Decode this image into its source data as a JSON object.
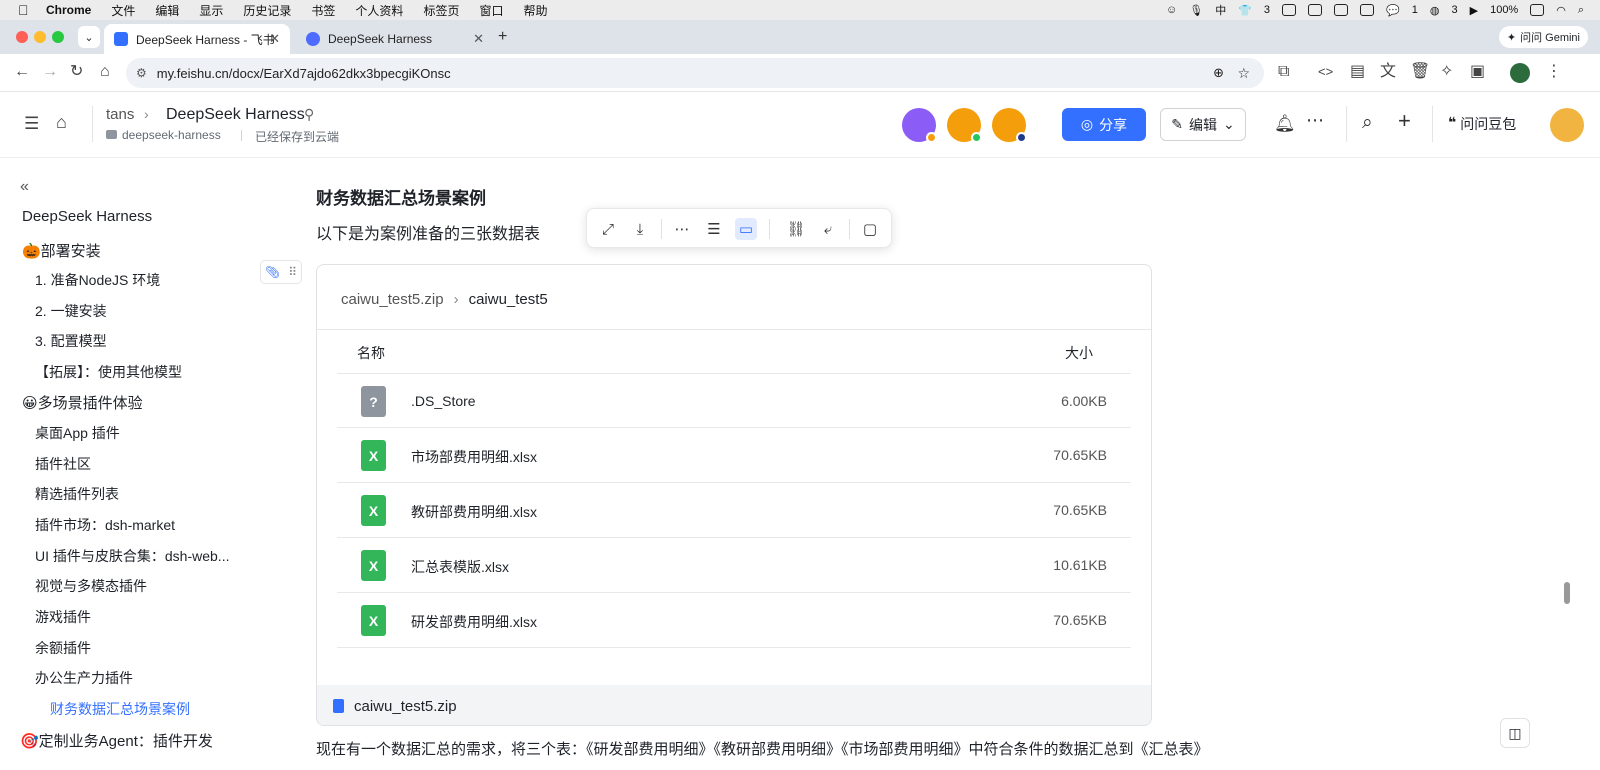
{
  "menubar": {
    "app": "Chrome",
    "items": [
      "文件",
      "编辑",
      "显示",
      "历史记录",
      "书签",
      "个人资料",
      "标签页",
      "窗口",
      "帮助"
    ],
    "status": {
      "count1": "3",
      "count2": "1",
      "count3": "3",
      "battery": "100%"
    }
  },
  "tabs": [
    {
      "title": "DeepSeek Harness - 飞书云文",
      "active": true
    },
    {
      "title": "DeepSeek Harness",
      "active": false
    }
  ],
  "tabstrip_right": "问问 Gemini",
  "address": {
    "url": "my.feishu.cn/docx/EarXd7ajdo62dkx3bpecgiKOnsc"
  },
  "header": {
    "breadcrumb_root": "tans",
    "doc_title": "DeepSeek Harness",
    "folder": "deepseek-harness",
    "save_status": "已经保存到云端",
    "share_label": "分享",
    "edit_label": "编辑",
    "ask_label": "问问豆包"
  },
  "sidebar": {
    "title": "DeepSeek Harness",
    "items": [
      {
        "label": "🎃部署安装",
        "level": 1
      },
      {
        "label": "1. 准备NodeJS 环境",
        "level": 2
      },
      {
        "label": "2. 一键安装",
        "level": 2
      },
      {
        "label": "3. 配置模型",
        "level": 2
      },
      {
        "label": "【拓展】：使用其他模型",
        "level": 2
      },
      {
        "label": "😀多场景插件体验",
        "level": 1
      },
      {
        "label": "桌面App 插件",
        "level": 2
      },
      {
        "label": "插件社区",
        "level": 2
      },
      {
        "label": "精选插件列表",
        "level": 2
      },
      {
        "label": "插件市场：dsh-market",
        "level": 2
      },
      {
        "label": "UI 插件与皮肤合集：dsh-web...",
        "level": 2
      },
      {
        "label": "视觉与多模态插件",
        "level": 2
      },
      {
        "label": "游戏插件",
        "level": 2
      },
      {
        "label": "余额插件",
        "level": 2
      },
      {
        "label": "办公生产力插件",
        "level": 2
      },
      {
        "label": "财务数据汇总场景案例",
        "level": 3
      },
      {
        "label": "🎯定制业务Agent：插件开发",
        "level": 1
      }
    ]
  },
  "content": {
    "heading": "财务数据汇总场景案例",
    "intro": "以下是为案例准备的三张数据表",
    "archive": {
      "zip_name": "caiwu_test5.zip",
      "folder_name": "caiwu_test5",
      "col_name": "名称",
      "col_size": "大小",
      "files": [
        {
          "name": ".DS_Store",
          "size": "6.00KB",
          "type": "unknown"
        },
        {
          "name": "市场部费用明细.xlsx",
          "size": "70.65KB",
          "type": "excel"
        },
        {
          "name": "教研部费用明细.xlsx",
          "size": "70.65KB",
          "type": "excel"
        },
        {
          "name": "汇总表模版.xlsx",
          "size": "10.61KB",
          "type": "excel"
        },
        {
          "name": "研发部费用明细.xlsx",
          "size": "70.65KB",
          "type": "excel"
        }
      ],
      "footer_name": "caiwu_test5.zip"
    },
    "bottom_text": "现在有一个数据汇总的需求，将三个表：《研发部费用明细》《教研部费用明细》《市场部费用明细》中符合条件的数据汇总到《汇总表》"
  },
  "icons": {
    "unknown_file": "?",
    "excel_file": "X"
  },
  "colors": {
    "accent": "#3370ff",
    "excel_green": "#33b55a",
    "unknown_gray": "#8f959e"
  }
}
